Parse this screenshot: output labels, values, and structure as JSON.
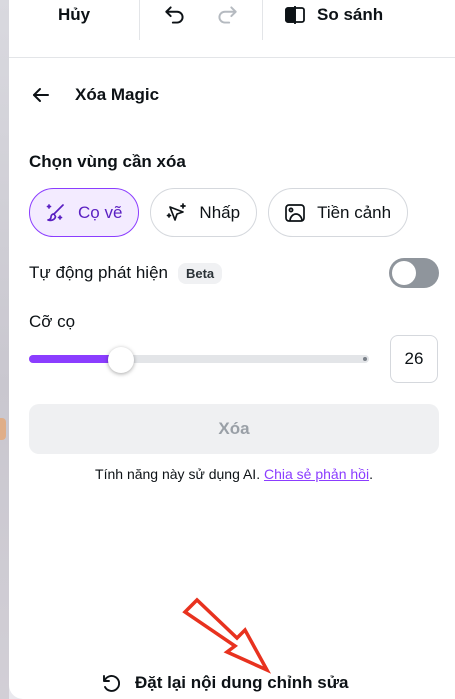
{
  "toolbar": {
    "cancel_label": "Hủy",
    "compare_label": "So sánh"
  },
  "panel": {
    "title": "Xóa Magic",
    "section_label": "Chọn vùng cần xóa",
    "modes": [
      {
        "label": "Cọ vẽ",
        "icon": "brush-icon",
        "active": true
      },
      {
        "label": "Nhấp",
        "icon": "click-sparkle-icon",
        "active": false
      },
      {
        "label": "Tiền cảnh",
        "icon": "foreground-image-icon",
        "active": false
      }
    ],
    "auto_detect": {
      "label": "Tự động phát hiện",
      "badge": "Beta",
      "enabled": false
    },
    "brush": {
      "label": "Cỡ cọ",
      "value": "26",
      "slider_fraction": 0.27
    },
    "erase_label": "Xóa",
    "ai_note": {
      "text": "Tính năng này sử dụng AI.",
      "link": "Chia sẻ phản hồi",
      "suffix": "."
    },
    "reset_label": "Đặt lại nội dung chỉnh sửa"
  },
  "colors": {
    "accent": "#8b3dff",
    "annotation_arrow": "#e8321f"
  }
}
